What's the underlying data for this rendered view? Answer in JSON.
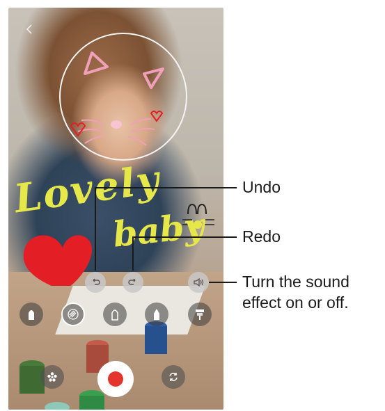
{
  "screen": {
    "back_icon": "chevron-left-icon",
    "drawing_text": [
      "Lovely",
      "baby"
    ]
  },
  "controls": {
    "undo_icon": "undo-icon",
    "redo_icon": "redo-icon",
    "sound_icon": "speaker-icon",
    "tools": [
      "marker-pen-icon",
      "pattern-pen-icon",
      "outline-pen-icon",
      "crayon-icon",
      "brush-icon"
    ],
    "selected_tool_index": 1,
    "bottom": [
      "effects-icon",
      "record-button",
      "switch-camera-icon"
    ]
  },
  "callouts": {
    "undo": "Undo",
    "redo": "Redo",
    "sound_line1": "Turn the sound",
    "sound_line2": "effect on or off."
  },
  "colors": {
    "record": "#e4352c",
    "doodle_yellow": "#e6e84a",
    "doodle_red": "#e31e24",
    "doodle_pink": "#f2a6b8"
  }
}
